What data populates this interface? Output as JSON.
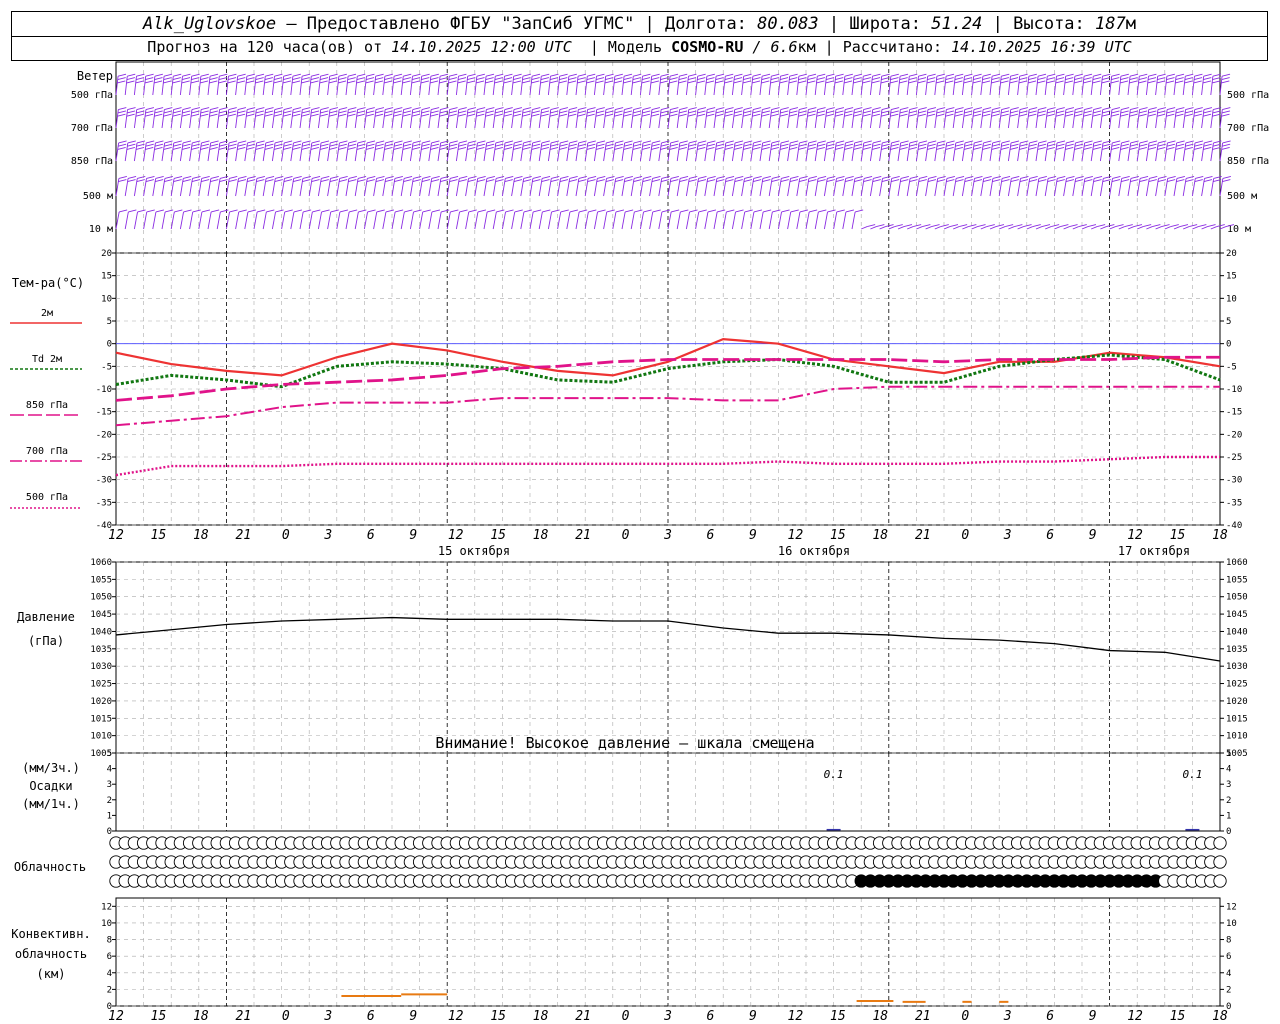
{
  "header": {
    "station": "Alk_Uglovskoe",
    "provider": "– Предоставлено ФГБУ \"ЗапСиб УГМС\"",
    "lon_label": "Долгота:",
    "lon": "80.083",
    "lat_label": "Широта:",
    "lat": "51.24",
    "alt_label": "Высота:",
    "alt": "187",
    "alt_unit": "м",
    "forecast_label": "Прогноз на 120 часа(ов) от",
    "forecast_from": "14.10.2025 12:00 UTC",
    "model_label": "Модель",
    "model": "COSMO-RU",
    "resolution": "/ 6.6",
    "resolution_unit": "км",
    "calc_label": "Рассчитано:",
    "calc_time": "14.10.2025 16:39 UTC"
  },
  "colors": {
    "wind": "#8a2be2",
    "t2m": "#ee3333",
    "td2m": "#117711",
    "t850": "#e0138a",
    "t700": "#e0138a",
    "t500": "#e0138a",
    "zero_line": "#4444ff",
    "pressure": "#000000",
    "precip": "#3333aa",
    "conv": "#e87a12"
  },
  "x_axis": {
    "hour_labels": [
      "12",
      "15",
      "18",
      "21",
      "0",
      "3",
      "6",
      "9",
      "12",
      "15",
      "18",
      "21",
      "0",
      "3",
      "6",
      "9",
      "12",
      "15",
      "18",
      "21",
      "0",
      "3",
      "6",
      "9",
      "12",
      "15",
      "18"
    ],
    "day_labels": [
      "15 октября",
      "16 октября",
      "17 октября"
    ]
  },
  "wind_panel": {
    "title": "Ветер",
    "levels": [
      "500 гПа",
      "700 гПа",
      "850 гПа",
      "500 м",
      "10  м"
    ]
  },
  "chart_data": [
    {
      "type": "line",
      "name": "temperature",
      "ylabel": "Тем-ра(°C)",
      "ylim": [
        -40,
        20
      ],
      "yticks": [
        20,
        15,
        10,
        5,
        0,
        -5,
        -10,
        -15,
        -20,
        -25,
        -30,
        -35,
        -40
      ],
      "legend": [
        "2м",
        "Td  2м",
        "850 гПа",
        "700 гПа",
        "500 гПа"
      ],
      "x_hours": [
        0,
        6,
        12,
        18,
        24,
        30,
        36,
        42,
        48,
        54,
        60,
        66,
        72,
        78,
        84,
        90,
        96,
        102,
        108,
        114,
        120
      ],
      "series": [
        {
          "name": "2м",
          "values": [
            -2,
            -4.5,
            -6,
            -7,
            -3,
            0,
            -1.5,
            -4,
            -6,
            -7,
            -4,
            1,
            0,
            -3.5,
            -5,
            -6.5,
            -4,
            -4,
            -2,
            -3,
            -5
          ]
        },
        {
          "name": "Td  2м",
          "values": [
            -9,
            -7,
            -8,
            -9.5,
            -5,
            -4,
            -4.5,
            -5.5,
            -8,
            -8.5,
            -5.5,
            -4,
            -3.5,
            -5,
            -8.5,
            -8.5,
            -5,
            -3.5,
            -2.5,
            -3.5,
            -8
          ]
        },
        {
          "name": "850 гПа",
          "values": [
            -12.5,
            -11.5,
            -10,
            -9,
            -8.5,
            -8,
            -7,
            -5.5,
            -5,
            -4,
            -3.5,
            -3.5,
            -3.5,
            -3.5,
            -3.5,
            -4,
            -3.5,
            -3.5,
            -3.5,
            -3,
            -3
          ]
        },
        {
          "name": "700 гПа",
          "values": [
            -18,
            -17,
            -16,
            -14,
            -13,
            -13,
            -13,
            -12,
            -12,
            -12,
            -12,
            -12.5,
            -12.5,
            -10,
            -9.5,
            -9.5,
            -9.5,
            -9.5,
            -9.5,
            -9.5,
            -9.5
          ]
        },
        {
          "name": "500 гПа",
          "values": [
            -29,
            -27,
            -27,
            -27,
            -26.5,
            -26.5,
            -26.5,
            -26.5,
            -26.5,
            -26.5,
            -26.5,
            -26.5,
            -26,
            -26.5,
            -26.5,
            -26.5,
            -26,
            -26,
            -25.5,
            -25,
            -25
          ]
        }
      ]
    },
    {
      "type": "line",
      "name": "pressure",
      "ylabel": "Давление",
      "yunit": "(гПа)",
      "ylim": [
        1005,
        1060
      ],
      "yticks": [
        1060,
        1055,
        1050,
        1045,
        1040,
        1035,
        1030,
        1025,
        1020,
        1015,
        1010,
        1005
      ],
      "x_hours": [
        0,
        6,
        12,
        18,
        24,
        30,
        36,
        42,
        48,
        54,
        60,
        66,
        72,
        78,
        84,
        90,
        96,
        102,
        108,
        114,
        120
      ],
      "series": [
        {
          "name": "Давление",
          "values": [
            1039,
            1040.5,
            1042,
            1043,
            1043.5,
            1044,
            1043.5,
            1043.5,
            1043.5,
            1043,
            1043,
            1041,
            1039.5,
            1039.5,
            1039,
            1038,
            1037.5,
            1036.5,
            1034.5,
            1034,
            1031.5
          ]
        }
      ],
      "note": "Внимание! Высокое давление – шкала смещена"
    },
    {
      "type": "bar",
      "name": "precipitation",
      "ylabel_top": "(мм/3ч.)",
      "ylabel_mid": "Осадки",
      "ylabel_bot": "(мм/1ч.)",
      "ylim": [
        0,
        5
      ],
      "yticks": [
        5,
        4,
        3,
        2,
        1,
        0
      ],
      "x_hours": [
        78,
        117
      ],
      "values": [
        0.1,
        0.1
      ],
      "labels": [
        "0.1",
        "0.1"
      ]
    },
    {
      "type": "table",
      "name": "cloudiness",
      "ylabel": "Облачность",
      "rows": 3,
      "columns": 120,
      "bottom_row_overcast_from_hour": 81,
      "bottom_row_overcast_to_hour": 113
    },
    {
      "type": "bar",
      "name": "convective_cloud",
      "ylabel": [
        "Конвективн.",
        "облачность",
        "(км)"
      ],
      "ylim": [
        0,
        13
      ],
      "yticks": [
        12,
        10,
        8,
        6,
        4,
        2,
        0
      ],
      "segments": [
        {
          "from_hour": 24.5,
          "to_hour": 31,
          "value": 1.2
        },
        {
          "from_hour": 31,
          "to_hour": 36,
          "value": 1.4
        },
        {
          "from_hour": 80.5,
          "to_hour": 84.5,
          "value": 0.6
        },
        {
          "from_hour": 85.5,
          "to_hour": 88,
          "value": 0.5
        },
        {
          "from_hour": 92,
          "to_hour": 93,
          "value": 0.5
        },
        {
          "from_hour": 96,
          "to_hour": 97,
          "value": 0.5
        }
      ]
    }
  ]
}
